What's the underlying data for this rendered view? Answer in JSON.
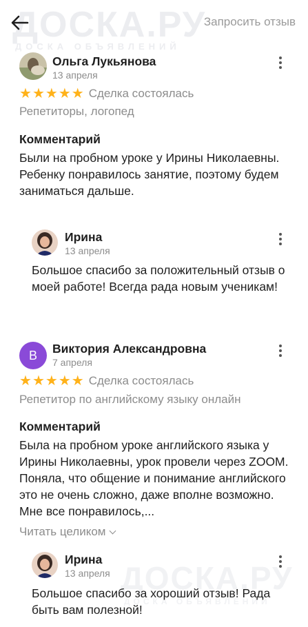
{
  "header": {
    "back_label": "Назад",
    "request_label": "Запросить отзыв"
  },
  "watermark": {
    "brand": "ДОСКА.РУ",
    "tagline": "ДОСКА ОБЪЯВЛЕНИЙ"
  },
  "reviews": [
    {
      "author": "Ольга Лукьянова",
      "date": "13 апреля",
      "stars": 5,
      "deal_status": "Сделка состоялась",
      "category": "Репетиторы, логопед",
      "comment_title": "Комментарий",
      "comment": "Были на пробном уроке у Ирины Николаевны. Ребенку понравилось занятие, поэтому будем заниматься дальше.",
      "reply": {
        "author": "Ирина",
        "date": "13 апреля",
        "text": "Большое спасибо за положительный отзыв о моей работе! Всегда рада новым ученикам!"
      }
    },
    {
      "author": "Виктория Александровна",
      "avatar_letter": "В",
      "date": "7 апреля",
      "stars": 5,
      "deal_status": "Сделка состоялась",
      "category": "Репетитор по английскому языку онлайн",
      "comment_title": "Комментарий",
      "comment": "Была на пробном уроке английского языка у Ирины Николаевны, урок провели через ZOOM. Поняла, что общение и понимание английского это не очень сложно, даже вполне возможно. Мне все понравилось,...",
      "read_more": "Читать целиком",
      "reply": {
        "author": "Ирина",
        "date": "13 апреля",
        "text": "Большое спасибо за хороший отзыв! Рада быть вам полезной!"
      }
    }
  ],
  "colors": {
    "star": "#ffb21a",
    "muted_text": "#8c8c8c",
    "letter_avatar": "#8a4ad8"
  }
}
